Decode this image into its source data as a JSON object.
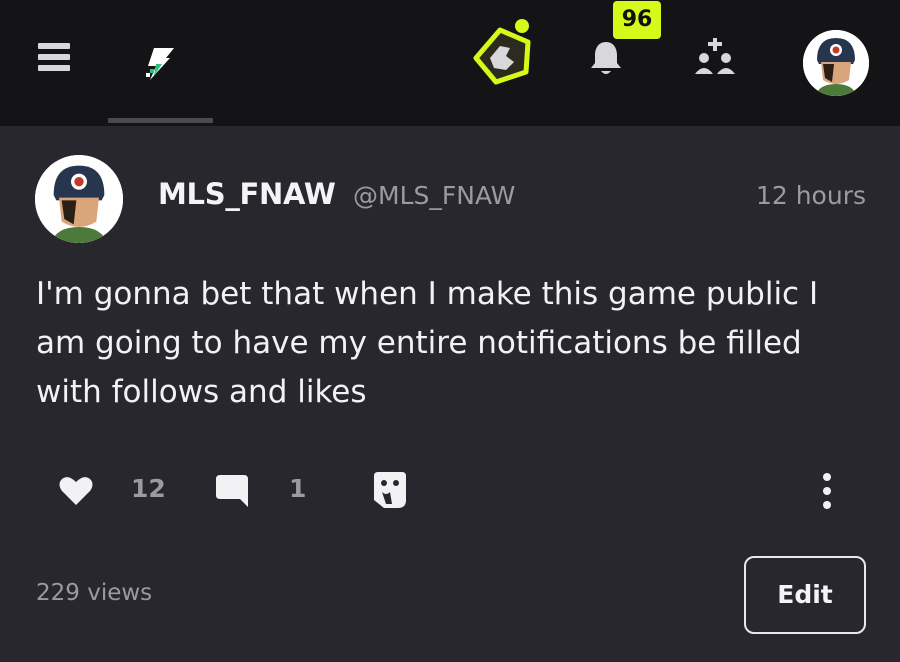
{
  "topbar": {
    "notification_count": "96",
    "accent_color": "#d6f91a",
    "icons": [
      "menu-icon",
      "bolt-icon",
      "app-logo-icon",
      "bell-icon",
      "add-user-icon"
    ]
  },
  "post": {
    "author_name": "MLS_FNAW",
    "author_handle": "@MLS_FNAW",
    "timestamp": "12 hours",
    "body": "I'm gonna bet that when I make this game public I am going to have my entire notifications be filled with follows and likes",
    "like_count": "12",
    "comment_count": "1",
    "views": "229 views",
    "edit_label": "Edit"
  }
}
